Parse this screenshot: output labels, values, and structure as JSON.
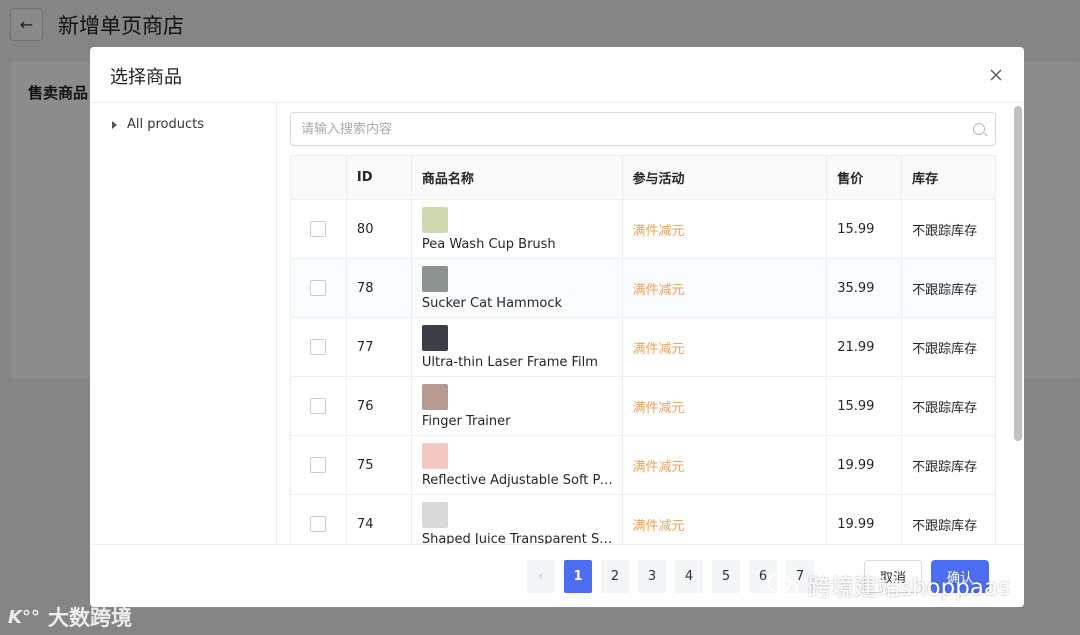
{
  "background": {
    "back_icon": "arrow-left-icon",
    "page_title": "新增单页商店",
    "card_title": "售卖商品"
  },
  "modal": {
    "title": "选择商品",
    "close_icon": "close-icon"
  },
  "tree": {
    "nodes": [
      {
        "label": "All products",
        "icon": "caret-right-icon"
      }
    ]
  },
  "search": {
    "placeholder": "请输入搜索内容",
    "value": "",
    "icon": "search-icon"
  },
  "table": {
    "headers": {
      "check": "",
      "id": "ID",
      "name": "商品名称",
      "activity": "参与活动",
      "price": "售价",
      "stock": "库存"
    },
    "rows": [
      {
        "id": "80",
        "name": "Pea Wash Cup Brush",
        "activity": "满件减元",
        "price": "15.99",
        "stock": "不跟踪库存",
        "thumb_color": "#cfd8b0"
      },
      {
        "id": "78",
        "name": "Sucker Cat Hammock",
        "activity": "满件减元",
        "price": "35.99",
        "stock": "不跟踪库存",
        "thumb_color": "#8c9290"
      },
      {
        "id": "77",
        "name": "Ultra-thin Laser Frame Film",
        "activity": "满件减元",
        "price": "21.99",
        "stock": "不跟踪库存",
        "thumb_color": "#3b3f45"
      },
      {
        "id": "76",
        "name": "Finger Trainer",
        "activity": "满件减元",
        "price": "15.99",
        "stock": "不跟踪库存",
        "thumb_color": "#b69a92"
      },
      {
        "id": "75",
        "name": "Reflective Adjustable Soft Pa...",
        "activity": "满件减元",
        "price": "19.99",
        "stock": "不跟踪库存",
        "thumb_color": "#f2c9c4"
      },
      {
        "id": "74",
        "name": "Shaped Juice Transparent St...",
        "activity": "满件减元",
        "price": "19.99",
        "stock": "不跟踪库存",
        "thumb_color": "#d9d9d9"
      }
    ]
  },
  "pagination": {
    "prev_icon": "chevron-left-icon",
    "pages": [
      "1",
      "2",
      "3",
      "4",
      "5",
      "6",
      "7"
    ],
    "current": "1"
  },
  "footer": {
    "cancel_label": "取消",
    "confirm_label": "确认"
  },
  "watermarks": {
    "right_text": "跨境建站shoppaas",
    "left_logo": "K°°",
    "left_text": "大数跨境"
  },
  "colors": {
    "accent": "#4e6ef2",
    "activity": "#f0a35a",
    "overlay": "rgba(0,0,0,0.45)"
  }
}
